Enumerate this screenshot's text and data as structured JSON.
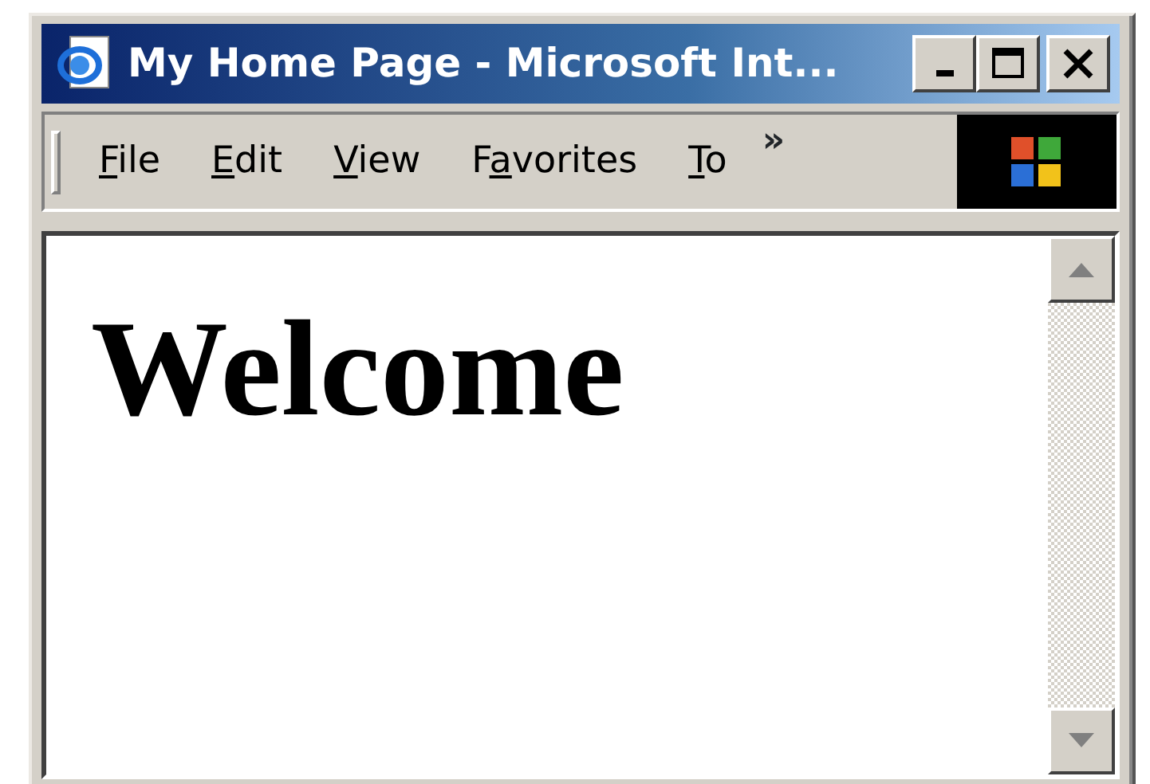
{
  "window": {
    "title": "My Home Page - Microsoft Int..."
  },
  "menu": [
    {
      "mnemonic": "F",
      "rest": "ile"
    },
    {
      "mnemonic": "E",
      "rest": "dit"
    },
    {
      "mnemonic": "V",
      "rest": "iew"
    },
    {
      "lead": "F",
      "mnemonic": "a",
      "rest": "vorites"
    },
    {
      "mnemonic": "T",
      "rest": "o"
    }
  ],
  "menu_overflow": "»",
  "document": {
    "heading": "Welcome"
  },
  "scrollbar": {
    "disabled": true
  }
}
